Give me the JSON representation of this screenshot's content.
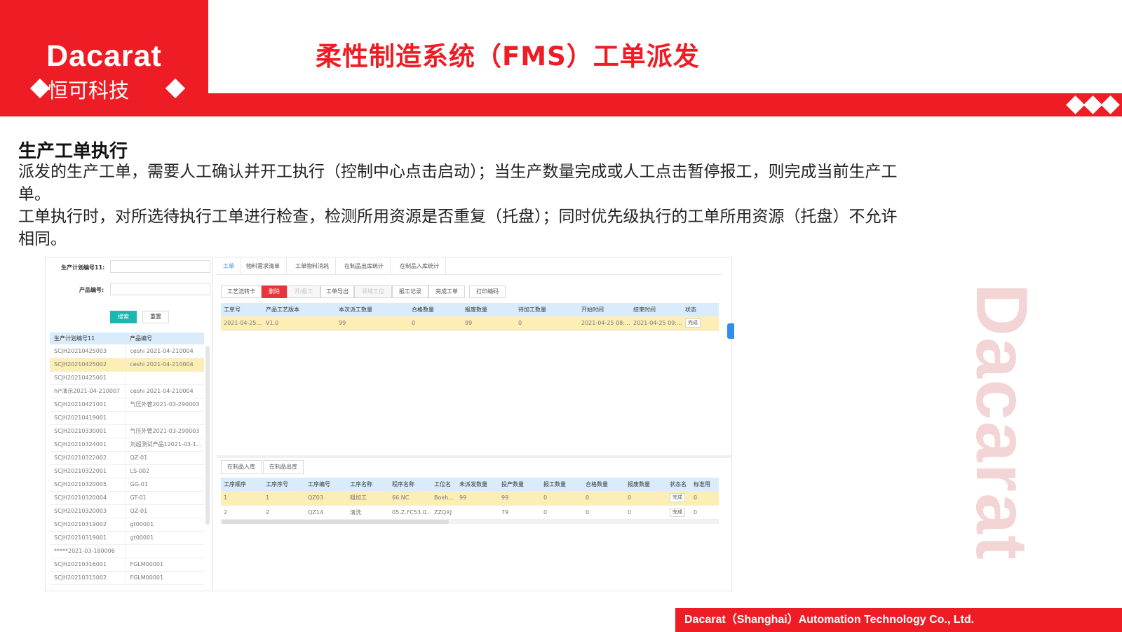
{
  "brand": {
    "logo_en": "Dacarat",
    "logo_cn": "恒可科技",
    "watermark": "Dacarat",
    "footer": "Dacarat（Shanghai）Automation Technology Co., Ltd."
  },
  "colors": {
    "accent": "#ee1c24",
    "teal": "#1bb7b0",
    "table_header": "#d9ecfb",
    "row_selected": "#fdeeb6",
    "link": "#2f8cf0"
  },
  "slide": {
    "title": "柔性制造系统（FMS）工单派发",
    "section_title": "生产工单执行",
    "para1": "派发的生产工单，需要人工确认并开工执行（控制中心点击启动）；当生产数量完成或人工点击暂停报工，则完成当前生产工单。",
    "para2": "工单执行时，对所选待执行工单进行检查，检测所用资源是否重复（托盘）；同时优先级执行的工单所用资源（托盘）不允许相同。"
  },
  "left_panel": {
    "plan_label": "生产计划编号11:",
    "product_label": "产品编号:",
    "search_btn": "搜索",
    "reset_btn": "重置",
    "columns": [
      "生产计划编号11",
      "产品编号"
    ],
    "rows": [
      [
        "SCJH20210425003",
        "ceshi 2021-04-210004"
      ],
      [
        "SCJH20210425002",
        "ceshi 2021-04-210004"
      ],
      [
        "SCJH20210425001",
        ""
      ],
      [
        "hi*演示2021-04-210007",
        "ceshi 2021-04-210004"
      ],
      [
        "SCJH20210421001",
        "气压外管2021-03-290003"
      ],
      [
        "SCJH20210419001",
        ""
      ],
      [
        "SCJH20210330001",
        "气压外管2021-03-290003"
      ],
      [
        "SCJH20210324001",
        "刘超测试产品12021-03-1..."
      ],
      [
        "SCJH20210322002",
        "QZ-01"
      ],
      [
        "SCJH20210322001",
        "LS-002"
      ],
      [
        "SCJH20210320005",
        "GG-01"
      ],
      [
        "SCJH20210320004",
        "GT-01"
      ],
      [
        "SCJH20210320003",
        "QZ-01"
      ],
      [
        "SCJH20210319002",
        "gt00001"
      ],
      [
        "SCJH20210319001",
        "gt00001"
      ],
      [
        "*****2021-03-180006",
        ""
      ],
      [
        "SCJH20210316001",
        "FGLM00001"
      ],
      [
        "SCJH20210315002",
        "FGLM00001"
      ]
    ]
  },
  "tabs": [
    "工单",
    "物料需求清单",
    "工单物料消耗",
    "在制品出库统计",
    "在制品入库统计"
  ],
  "toolbar": [
    "工艺流转卡",
    "删除",
    "开/报工",
    "工单导出",
    "领域工位",
    "报工记录",
    "完成工单",
    "打印编码"
  ],
  "workorder_grid": {
    "columns": [
      "工单号",
      "产品工艺版本",
      "本次派工数量",
      "合格数量",
      "报废数量",
      "待加工数量",
      "开始时间",
      "结束时间",
      "状态"
    ],
    "rows": [
      [
        "2021-04-25...",
        "V1.0",
        "99",
        "0",
        "99",
        "0",
        "2021-04-25 08:...",
        "2021-04-25 09:...",
        "完成"
      ]
    ]
  },
  "sub_tabs": [
    "在制品入库",
    "在制品出库"
  ],
  "process_grid": {
    "columns": [
      "工序顺序",
      "工序序号",
      "工序编号",
      "工序名称",
      "程序名称",
      "工位名",
      "未派发数量",
      "投产数量",
      "报工数量",
      "合格数量",
      "报废数量",
      "状态名",
      "标准用"
    ],
    "rows": [
      [
        "1",
        "1",
        "QZ03",
        "粗加工",
        "66.NC",
        "Boeh...",
        "99",
        "99",
        "0",
        "0",
        "0",
        "完成",
        "0"
      ],
      [
        "2",
        "2",
        "QZ14",
        "清洗",
        "05.Z.FC53.0...",
        "ZZQXJ",
        "",
        "79",
        "0",
        "0",
        "0",
        "完成",
        "0"
      ]
    ]
  }
}
